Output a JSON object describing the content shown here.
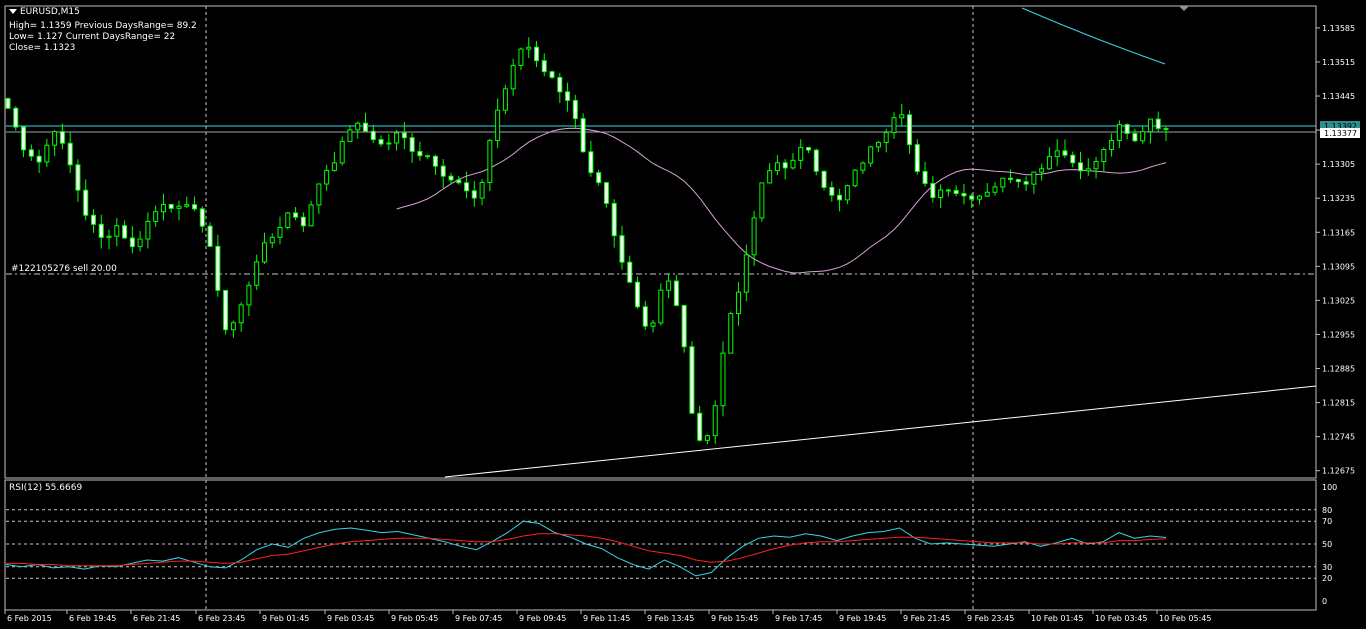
{
  "header": {
    "symbol": "EURUSD,M15",
    "line1": "High= 1.1359 Previous DaysRange= 89.2",
    "line2": "Low= 1.127 Current DaysRange= 22",
    "line3": "Close= 1.1323"
  },
  "order_label": "#122105276 sell 20.00",
  "rsi_label": "RSI(12) 55.6669",
  "colors": {
    "background": "#000000",
    "bull": "#00ff00",
    "candle_body_fill": "#000000",
    "bear_body_fill": "#ffffff",
    "ma": "#d8a4d8",
    "channel": "#3ad4e8",
    "trendline": "#ffffff",
    "rsi": "#3ad4e8",
    "rsi_signal": "#ff2020",
    "bid_badge": "#2f8f8f",
    "ask_badge": "#ffffff"
  },
  "chart_data": [
    {
      "type": "candlestick",
      "title": "EURUSD,M15",
      "price_axis_ticks": [
        "1.13585",
        "1.13515",
        "1.13445",
        "1.13375",
        "1.13305",
        "1.13235",
        "1.13165",
        "1.13095",
        "1.13025",
        "1.12955",
        "1.12885",
        "1.12815",
        "1.12745",
        "1.12675"
      ],
      "ylim": [
        1.1266,
        1.1363
      ],
      "current_price_labels": [
        "1.13392",
        "1.13377"
      ],
      "order_line_price": 1.1308,
      "time_axis_labels": [
        "6 Feb 2015",
        "6 Feb 19:45",
        "6 Feb 21:45",
        "6 Feb 23:45",
        "9 Feb 01:45",
        "9 Feb 03:45",
        "9 Feb 05:45",
        "9 Feb 07:45",
        "9 Feb 09:45",
        "9 Feb 11:45",
        "9 Feb 13:45",
        "9 Feb 15:45",
        "9 Feb 17:45",
        "9 Feb 19:45",
        "9 Feb 21:45",
        "9 Feb 23:45",
        "10 Feb 01:45",
        "10 Feb 03:45",
        "10 Feb 05:45"
      ],
      "close_path": [
        1.1342,
        1.1334,
        1.1331,
        1.1338,
        1.133,
        1.132,
        1.1315,
        1.1318,
        1.1313,
        1.1319,
        1.1323,
        1.1321,
        1.1322,
        1.1312,
        1.1295,
        1.1302,
        1.1312,
        1.1316,
        1.1321,
        1.1318,
        1.1328,
        1.1332,
        1.1339,
        1.1337,
        1.1334,
        1.1337,
        1.1333,
        1.1332,
        1.1328,
        1.1326,
        1.1322,
        1.1339,
        1.1348,
        1.1356,
        1.1351,
        1.1347,
        1.1343,
        1.1329,
        1.1325,
        1.1312,
        1.1304,
        1.1295,
        1.1309,
        1.1298,
        1.1272,
        1.1277,
        1.1298,
        1.1308,
        1.1325,
        1.1331,
        1.133,
        1.1335,
        1.1327,
        1.1322,
        1.1328,
        1.1333,
        1.1337,
        1.1343,
        1.1329,
        1.1324,
        1.1326,
        1.1324,
        1.1324,
        1.1326,
        1.1328,
        1.1327,
        1.133,
        1.1334,
        1.1331,
        1.1329,
        1.1333,
        1.1338,
        1.1335,
        1.134,
        1.1337
      ]
    },
    {
      "type": "line",
      "title": "RSI(12) 55.6669",
      "ylim": [
        0,
        100
      ],
      "y_ticks": [
        100,
        80,
        70,
        50,
        30,
        20,
        0
      ],
      "levels": [
        80,
        70,
        50,
        30,
        20
      ],
      "series": [
        {
          "name": "RSI(12)",
          "values": [
            32,
            30,
            32,
            29,
            30,
            28,
            31,
            30,
            33,
            36,
            35,
            38,
            34,
            30,
            29,
            36,
            45,
            50,
            47,
            55,
            60,
            63,
            64,
            62,
            60,
            61,
            58,
            55,
            52,
            48,
            45,
            52,
            60,
            70,
            68,
            60,
            56,
            50,
            46,
            38,
            32,
            28,
            36,
            30,
            22,
            25,
            38,
            48,
            55,
            57,
            56,
            59,
            57,
            53,
            57,
            60,
            61,
            64,
            55,
            50,
            51,
            50,
            49,
            48,
            50,
            52,
            48,
            51,
            55,
            50,
            52,
            60,
            55,
            57,
            55.67
          ]
        },
        {
          "name": "Signal",
          "values": [
            33,
            33,
            32,
            32,
            31,
            31,
            31,
            31,
            32,
            33,
            34,
            35,
            35,
            34,
            33,
            34,
            37,
            40,
            41,
            44,
            47,
            50,
            52,
            53,
            54,
            55,
            55,
            55,
            54,
            53,
            52,
            52,
            54,
            57,
            59,
            59,
            58,
            57,
            55,
            52,
            48,
            44,
            42,
            40,
            36,
            34,
            35,
            38,
            42,
            46,
            49,
            51,
            52,
            52,
            53,
            54,
            55,
            56,
            56,
            55,
            54,
            53,
            52,
            51,
            51,
            51,
            50,
            50,
            51,
            51,
            51,
            53,
            53,
            54,
            54.5
          ]
        }
      ]
    }
  ]
}
